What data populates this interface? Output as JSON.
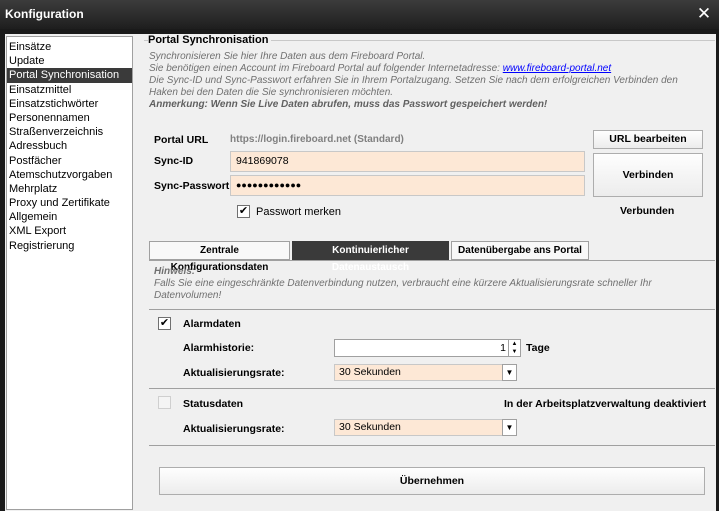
{
  "window": {
    "title": "Konfiguration",
    "close_icon": "close-icon"
  },
  "nav": {
    "items": [
      {
        "label": "Einsätze",
        "active": false
      },
      {
        "label": "Update",
        "active": false
      },
      {
        "label": "Portal Synchronisation",
        "active": true
      },
      {
        "label": "Einsatzmittel",
        "active": false
      },
      {
        "label": "Einsatzstichwörter",
        "active": false
      },
      {
        "label": "Personennamen",
        "active": false
      },
      {
        "label": "Straßenverzeichnis",
        "active": false
      },
      {
        "label": "Adressbuch",
        "active": false
      },
      {
        "label": "Postfächer",
        "active": false
      },
      {
        "label": "Atemschutzvorgaben",
        "active": false
      },
      {
        "label": "Mehrplatz",
        "active": false
      },
      {
        "label": "Proxy und Zertifikate",
        "active": false
      },
      {
        "label": "Allgemein",
        "active": false
      },
      {
        "label": "XML Export",
        "active": false
      },
      {
        "label": "Registrierung",
        "active": false
      }
    ]
  },
  "portal": {
    "group_title": "Portal Synchronisation",
    "desc_line1": "Synchronisieren Sie hier Ihre Daten aus dem Fireboard Portal.",
    "desc_line2": "Sie benötigen einen Account im Fireboard Portal auf folgender Internetadresse: ",
    "desc_link": "www.fireboard-portal.net",
    "desc_line3": "Die Sync-ID und Sync-Passwort erfahren Sie in Ihrem Portalzugang. Setzen Sie nach dem erfolgreichen Verbinden den Haken bei den Daten die Sie synchronisieren möchten.",
    "desc_warning": "Anmerkung: Wenn Sie Live Daten abrufen, muss das Passwort gespeichert werden!",
    "url_label": "Portal URL",
    "url_value": "https://login.fireboard.net (Standard)",
    "url_edit_button": "URL bearbeiten",
    "sync_id_label": "Sync-ID",
    "sync_id_value": "941869078",
    "sync_password_label": "Sync-Passwort",
    "sync_password_value": "●●●●●●●●●●●●",
    "connect_button": "Verbinden",
    "remember_password_label": "Passwort merken",
    "remember_password_checked": "✔",
    "status": "Verbunden"
  },
  "tabs": [
    {
      "label": "Zentrale Konfigurationsdaten",
      "active": false
    },
    {
      "label": "Kontinuierlicher Datenaustausch",
      "active": true
    },
    {
      "label": "Datenübergabe ans Portal",
      "active": false
    }
  ],
  "panel": {
    "hint_title": "Hinweis:",
    "hint_text": "Falls Sie eine eingeschränkte Datenverbindung nutzen, verbraucht eine kürzere Aktualisierungsrate schneller Ihr Datenvolumen!",
    "alarm": {
      "label": "Alarmdaten",
      "checked": "✔",
      "history_label": "Alarmhistorie:",
      "history_value": "1",
      "history_unit": "Tage",
      "rate_label": "Aktualisierungsrate:",
      "rate_value": "30 Sekunden"
    },
    "status": {
      "label": "Statusdaten",
      "note": "In der Arbeitsplatzverwaltung deaktiviert",
      "rate_label": "Aktualisierungsrate:",
      "rate_value": "30 Sekunden"
    },
    "apply_button": "Übernehmen"
  }
}
